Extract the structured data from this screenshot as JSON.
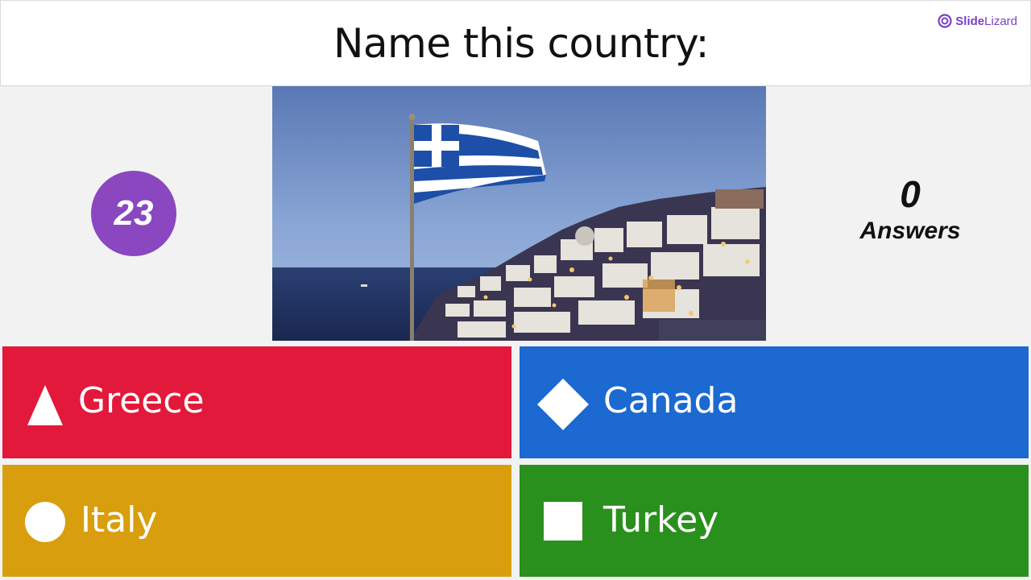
{
  "header": {
    "question": "Name this country:",
    "brand_bold": "Slide",
    "brand_regular": "Lizard"
  },
  "timer": {
    "value": "23"
  },
  "answers": {
    "count": "0",
    "label": "Answers"
  },
  "options": [
    {
      "label": "Greece",
      "shape": "triangle-icon",
      "color": "#e3193b"
    },
    {
      "label": "Canada",
      "shape": "diamond-icon",
      "color": "#1b69d1"
    },
    {
      "label": "Italy",
      "shape": "circle-icon",
      "color": "#d99e0e"
    },
    {
      "label": "Turkey",
      "shape": "square-icon",
      "color": "#2a901d"
    }
  ],
  "colors": {
    "accent": "#8a47c0",
    "background": "#f2f2f2"
  }
}
